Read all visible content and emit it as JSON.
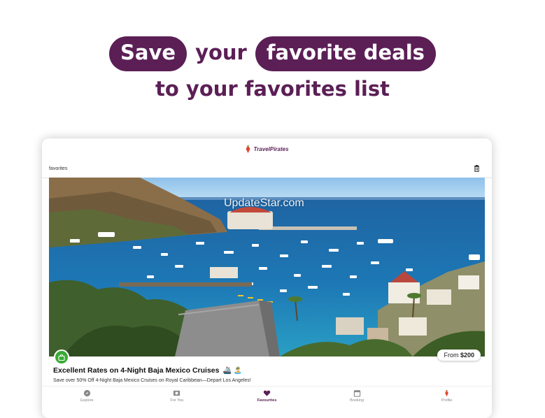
{
  "headline": {
    "word1": "Save",
    "word2": "your",
    "word3": "favorite deals",
    "line2": "to your favorites list"
  },
  "app": {
    "logo_text": "TravelPirates",
    "page_title": "favorites"
  },
  "deal": {
    "watermark": "UpdateStar.com",
    "price_prefix": "From",
    "price_value": "$200",
    "title": "Excellent Rates on 4-Night Baja Mexico Cruises",
    "title_emoji": "🚢 🏝️",
    "description": "Save over 50% Off 4-Night Baja Mexico Cruises on Royal Caribbean—Depart Los Angeles!"
  },
  "nav": {
    "items": [
      {
        "label": "Explore",
        "icon": "compass-icon"
      },
      {
        "label": "For You",
        "icon": "film-icon"
      },
      {
        "label": "Favourites",
        "icon": "heart-icon"
      },
      {
        "label": "Booking",
        "icon": "calendar-icon"
      },
      {
        "label": "Profile",
        "icon": "profile-icon"
      }
    ],
    "active": "Favourites"
  },
  "colors": {
    "brand": "#5b1f56",
    "badge_green": "#3aaa35"
  }
}
